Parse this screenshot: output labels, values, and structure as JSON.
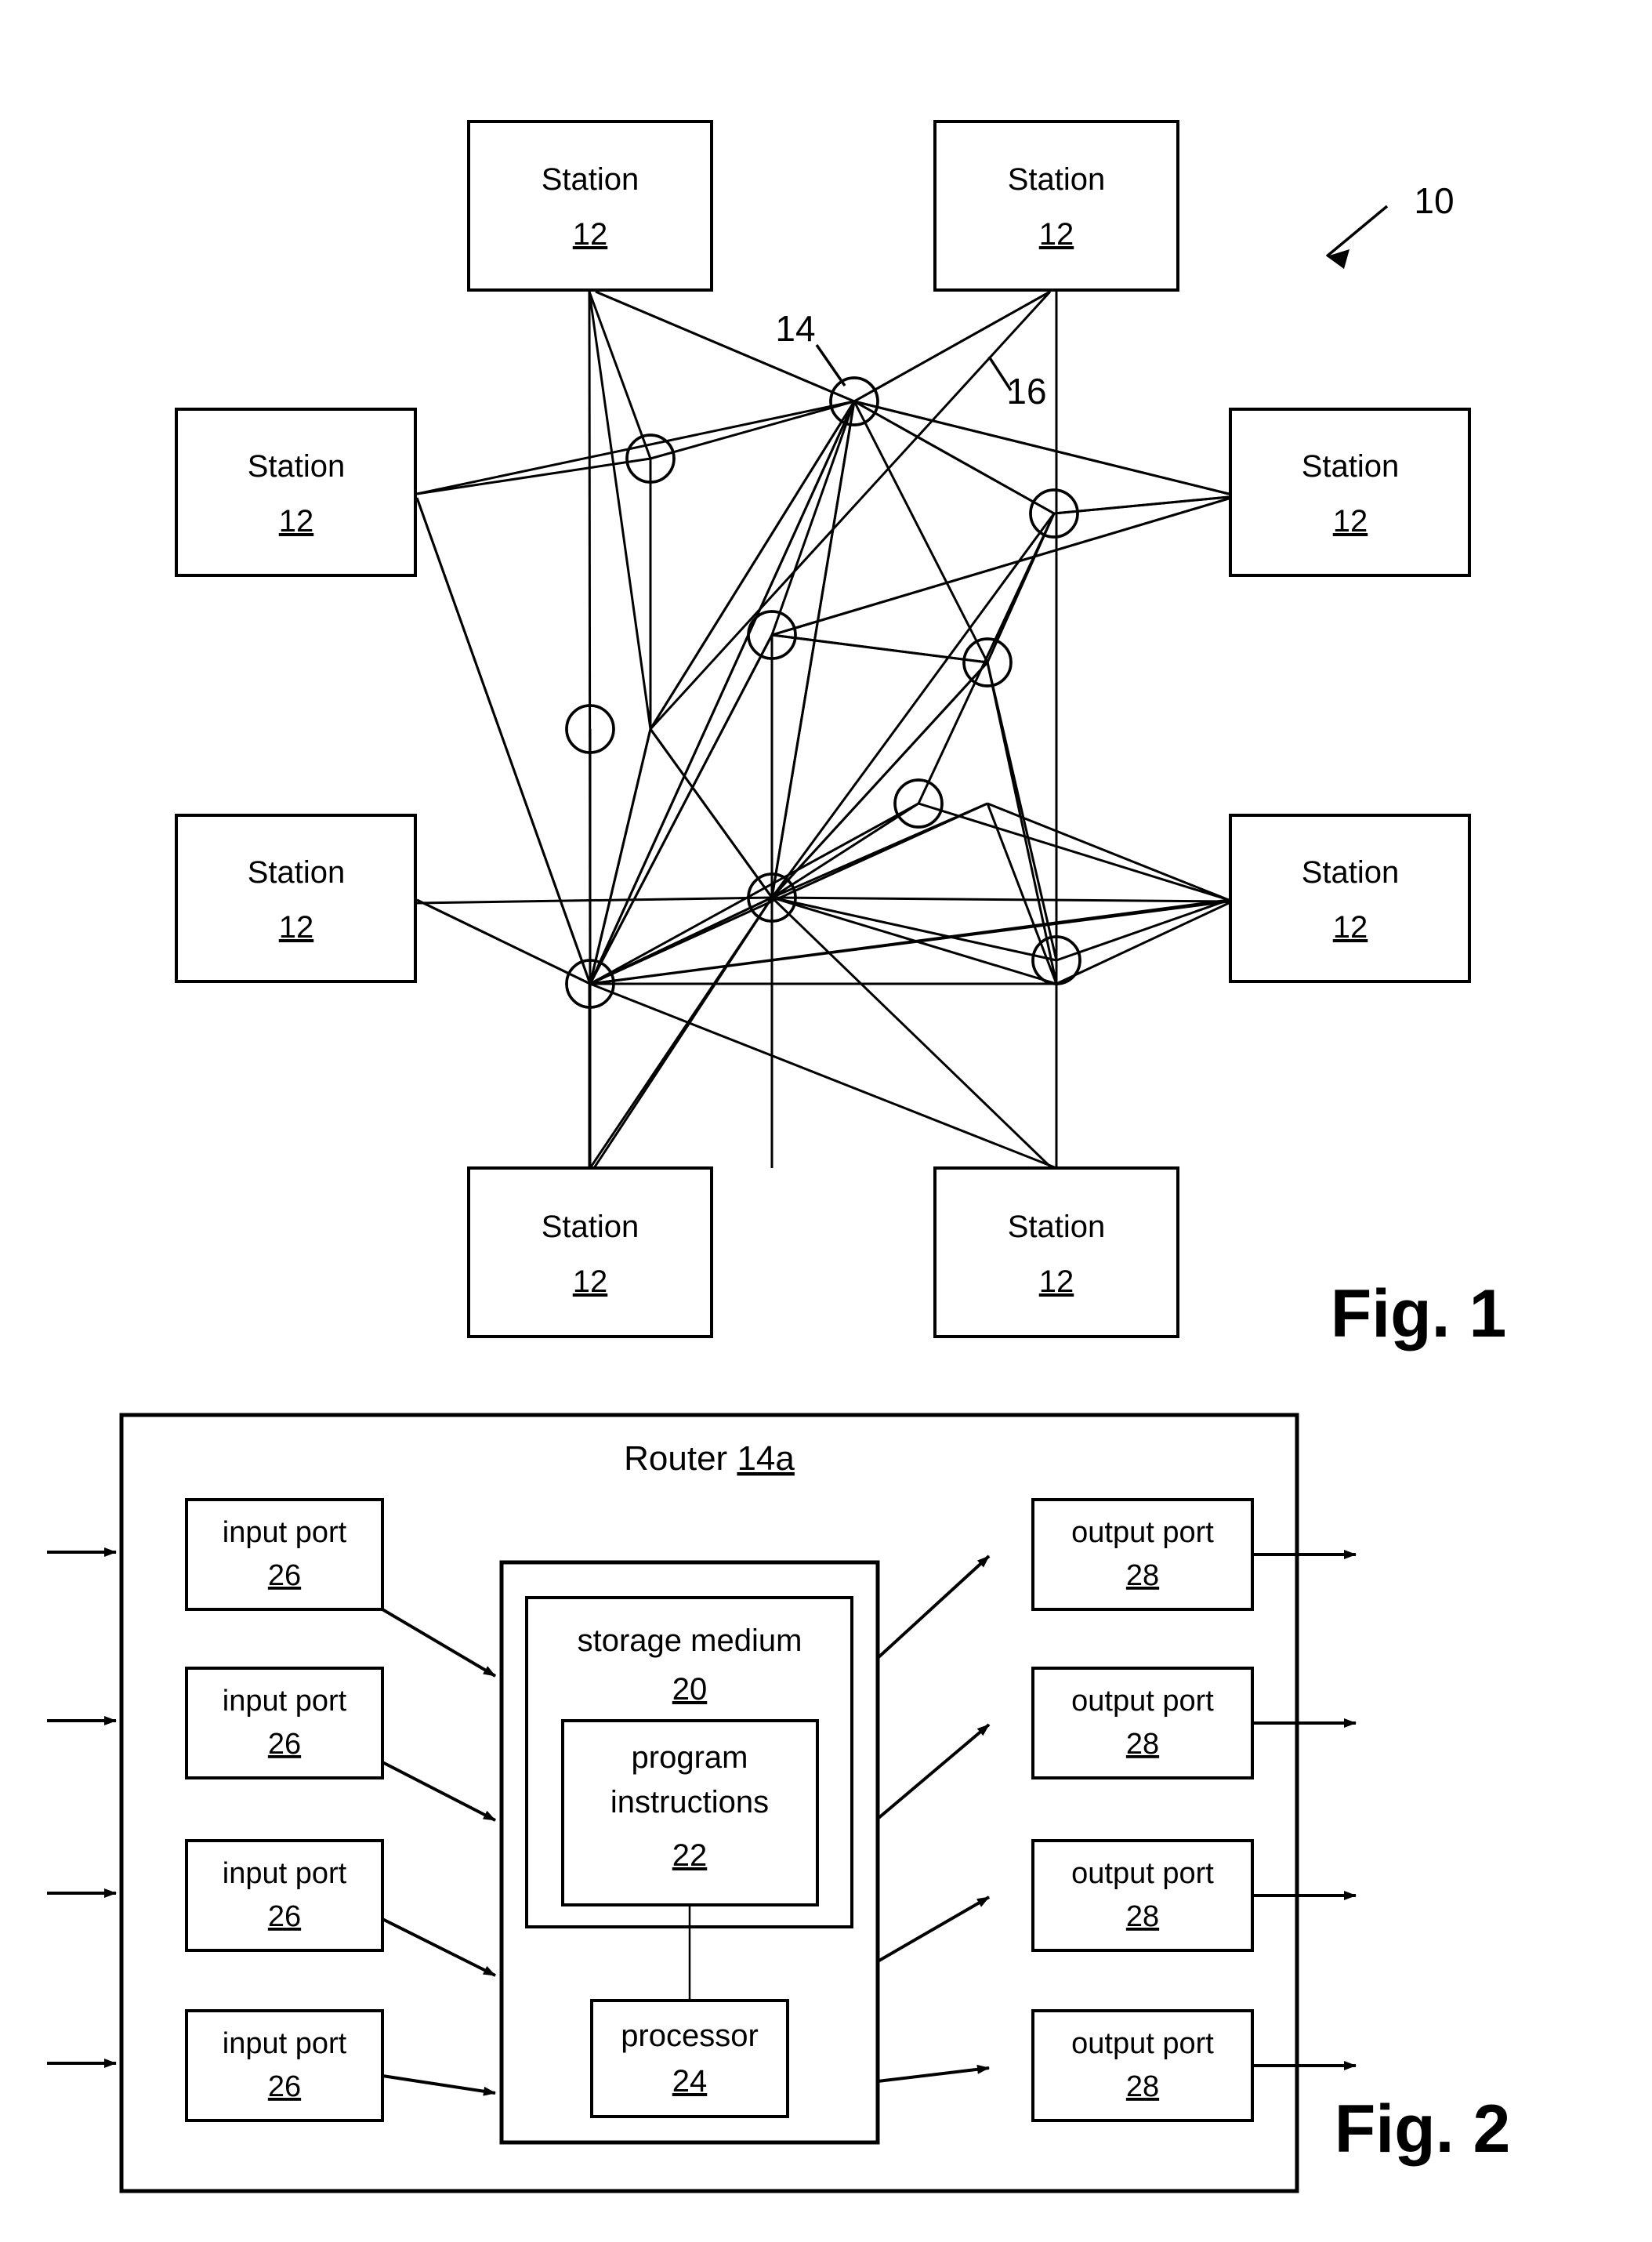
{
  "figures": [
    {
      "id": "fig1",
      "label": "Fig. 1",
      "system_ref": "10",
      "callouts": [
        {
          "name": "router-callout",
          "text": "14"
        },
        {
          "name": "link-callout",
          "text": "16"
        }
      ],
      "station_label": "Station",
      "station_ref": "12",
      "stations": [
        {
          "name": "station-top-left",
          "label": "Station",
          "ref": "12"
        },
        {
          "name": "station-top-right",
          "label": "Station",
          "ref": "12"
        },
        {
          "name": "station-left-upper",
          "label": "Station",
          "ref": "12"
        },
        {
          "name": "station-right-upper",
          "label": "Station",
          "ref": "12"
        },
        {
          "name": "station-left-lower",
          "label": "Station",
          "ref": "12"
        },
        {
          "name": "station-right-lower",
          "label": "Station",
          "ref": "12"
        },
        {
          "name": "station-bottom-left",
          "label": "Station",
          "ref": "12"
        },
        {
          "name": "station-bottom-right",
          "label": "Station",
          "ref": "12"
        }
      ],
      "router_node_count": 10,
      "router_node_ref": "14",
      "link_ref": "16"
    },
    {
      "id": "fig2",
      "label": "Fig. 2",
      "title_text": "Router",
      "title_ref": "14a",
      "input_ports": [
        {
          "label": "input port",
          "ref": "26"
        },
        {
          "label": "input port",
          "ref": "26"
        },
        {
          "label": "input port",
          "ref": "26"
        },
        {
          "label": "input port",
          "ref": "26"
        }
      ],
      "output_ports": [
        {
          "label": "output port",
          "ref": "28"
        },
        {
          "label": "output port",
          "ref": "28"
        },
        {
          "label": "output port",
          "ref": "28"
        },
        {
          "label": "output port",
          "ref": "28"
        }
      ],
      "storage_medium": {
        "label": "storage medium",
        "ref": "20"
      },
      "program_instructions": {
        "label_line1": "program",
        "label_line2": "instructions",
        "ref": "22"
      },
      "processor": {
        "label": "processor",
        "ref": "24"
      }
    }
  ],
  "colors": {
    "ink": "#000000",
    "paper": "#ffffff"
  }
}
